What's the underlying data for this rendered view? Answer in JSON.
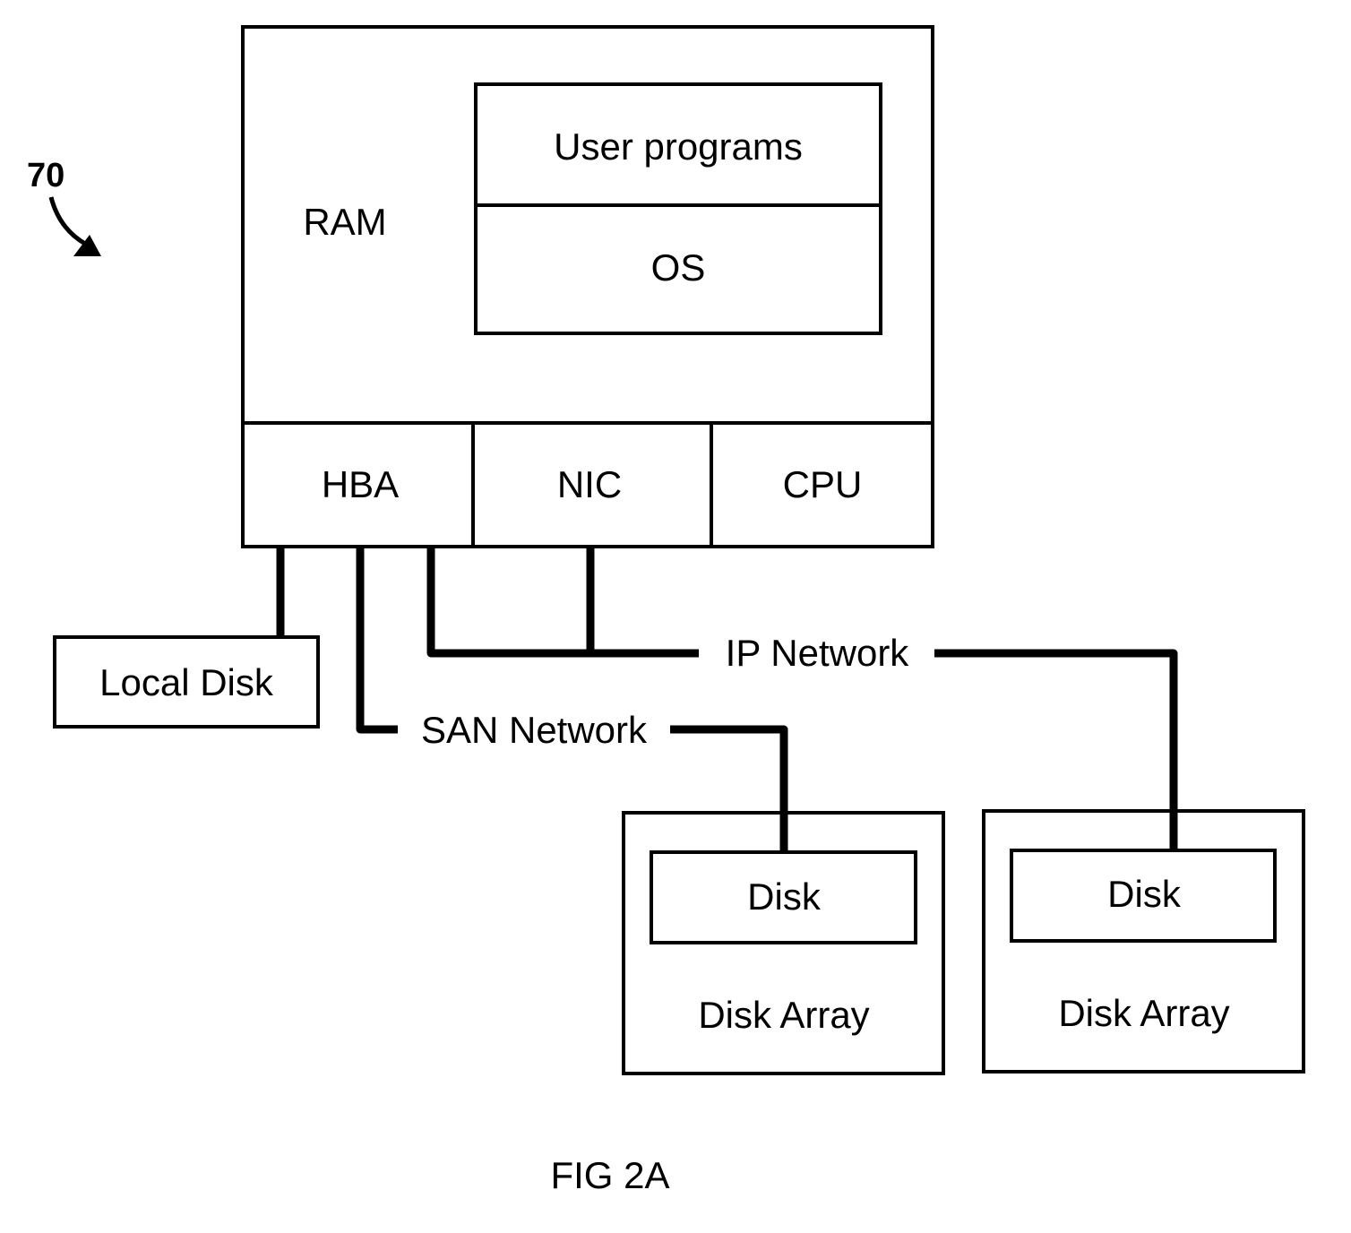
{
  "figure": {
    "reference_number": "70",
    "caption": "FIG 2A"
  },
  "host": {
    "ram_label": "RAM",
    "user_programs_label": "User programs",
    "os_label": "OS",
    "hba_label": "HBA",
    "nic_label": "NIC",
    "cpu_label": "CPU"
  },
  "local_disk": {
    "label": "Local Disk"
  },
  "networks": {
    "san_label": "SAN Network",
    "ip_label": "IP Network"
  },
  "disk_arrays": [
    {
      "disk_label": "Disk",
      "array_label": "Disk Array"
    },
    {
      "disk_label": "Disk",
      "array_label": "Disk Array"
    }
  ],
  "colors": {
    "ink": "#000000",
    "background": "#ffffff"
  }
}
